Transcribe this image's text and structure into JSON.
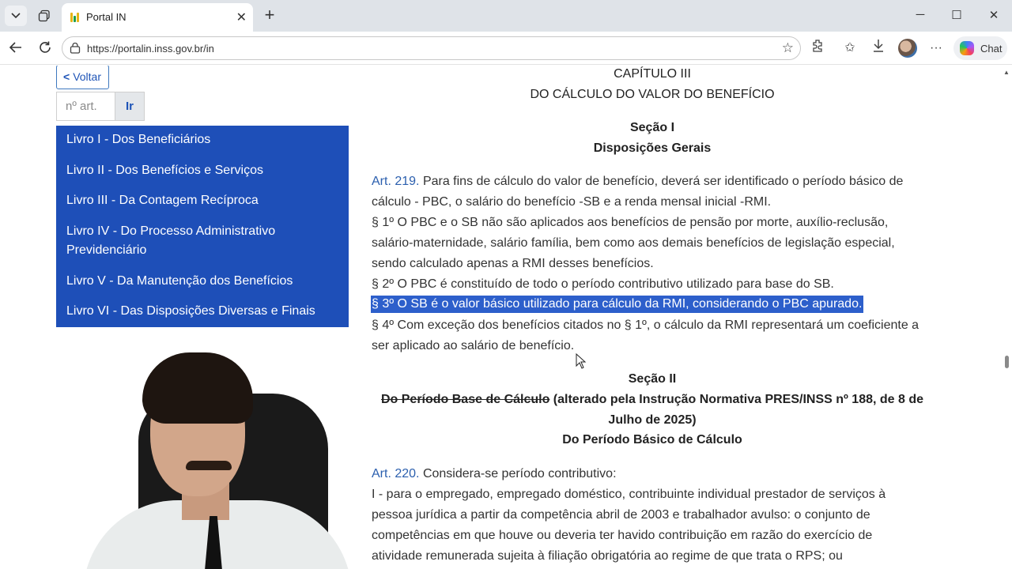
{
  "browser": {
    "tab_title": "Portal IN",
    "url": "https://portalin.inss.gov.br/in",
    "chat_label": "Chat",
    "favicon_colors": [
      "#e7b416",
      "#1e9e4a"
    ]
  },
  "sidebar": {
    "back_label": "Voltar",
    "article_placeholder": "nº art.",
    "go_label": "Ir",
    "items": [
      {
        "label": "Livro I - Dos Beneficiários"
      },
      {
        "label": "Livro II - Dos Benefícios e Serviços"
      },
      {
        "label": "Livro III - Da Contagem Recíproca"
      },
      {
        "label": "Livro IV - Do Processo Administrativo",
        "label2": "Previdenciário"
      },
      {
        "label": "Livro V - Da Manutenção dos Benefícios"
      },
      {
        "label": "Livro VI - Das Disposições Diversas e Finais"
      }
    ]
  },
  "document": {
    "chapter": "CAPÍTULO III",
    "chapter_title": "DO CÁLCULO DO VALOR DO BENEFÍCIO",
    "section1": "Seção I",
    "section1_title": "Disposições Gerais",
    "art219": {
      "label": "Art. 219.",
      "lines": [
        "Para fins de cálculo do valor de benefício, deverá ser identificado o período básico de",
        "cálculo - PBC, o salário do benefício -SB e a renda mensal inicial -RMI.",
        "§ 1º O PBC e o SB não são aplicados aos benefícios de pensão por morte, auxílio-reclusão,",
        "salário-maternidade, salário família, bem como aos demais benefícios de legislação especial,",
        "sendo calculado apenas a RMI desses benefícios.",
        "§ 2º O PBC é constituído de todo o período contributivo utilizado para base do SB.",
        "§ 3º O SB é o valor básico utilizado para cálculo da RMI, considerando o PBC apurado.",
        "§ 4º Com exceção dos benefícios citados no § 1º, o cálculo da RMI representará um coeficiente a",
        "ser aplicado ao salário de benefício."
      ]
    },
    "section2": "Seção II",
    "section2_struck": "Do Período Base de Cálculo",
    "section2_note": " (alterado pela Instrução Normativa PRES/INSS nº 188, de 8 de",
    "section2_note2": "Julho de 2025)",
    "section2_title": "Do Período Básico de Cálculo",
    "art220": {
      "label": "Art. 220.",
      "lines": [
        "Considera-se período contributivo:",
        "I - para o empregado, empregado doméstico, contribuinte individual prestador de serviços à",
        "pessoa jurídica a partir da competência abril de 2003 e trabalhador avulso: o conjunto de",
        "competências em que houve ou deveria ter havido contribuição em razão do exercício de",
        "atividade remunerada sujeita à filiação obrigatória ao regime de que trata o RPS; ou"
      ]
    }
  },
  "colors": {
    "menu_bg": "#1e4fb8",
    "highlight_bg": "#2d5fcb",
    "article_link": "#2b5fae"
  }
}
